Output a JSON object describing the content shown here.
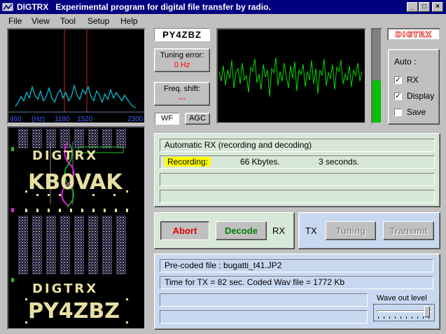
{
  "window": {
    "app_name": "DIGTRX",
    "subtitle": "Experimental program for digital file transfer by radio.",
    "controls": [
      "_",
      "□",
      "×"
    ]
  },
  "menu": [
    "File",
    "View",
    "Tool",
    "Setup",
    "Help"
  ],
  "spectrum": {
    "axis_labels": [
      "460",
      "(Hz)",
      "1180",
      "1520",
      "2300"
    ]
  },
  "waterfall": {
    "texts": [
      "DIGTRX",
      "KB0VAK",
      "DIGTRX",
      "PY4ZBZ"
    ]
  },
  "callsign": "PY4ZBZ",
  "tuning_error": {
    "label": "Tuning error:",
    "value": "0 Hz"
  },
  "freq_shift": {
    "label": "Freq. shift:",
    "value": "---"
  },
  "buttons": {
    "wf": "WF",
    "agc": "AGC"
  },
  "logo_text": "DIGTRX",
  "meter_level_percent": 45,
  "auto": {
    "title": "Auto :",
    "rx": {
      "label": "RX",
      "checked": true
    },
    "display": {
      "label": "Display",
      "checked": true
    },
    "save": {
      "label": "Save",
      "checked": false
    }
  },
  "status": {
    "line1": "Automatic RX (recording and decoding)",
    "recording_label": "Recording:",
    "kbytes": "66  Kbytes.",
    "seconds": "3  seconds."
  },
  "rx_controls": {
    "abort": "Abort",
    "decode": "Decode",
    "label": "RX"
  },
  "tx_controls": {
    "label": "TX",
    "tuning": "Tuning",
    "transmit": "Transmit"
  },
  "tx_info": {
    "precoded": "Pre-coded file : bugatti_t41.JP2",
    "time": "Time for TX = 82 sec.    Coded Wav file = 1772 Kb",
    "wave_out_label": "Wave out level"
  },
  "colors": {
    "title_bg": "#000080",
    "error_red": "#ff0000",
    "spectrum_trace": "#00c8d8",
    "scope_trace": "#00e000",
    "recording_highlight": "#ffff00",
    "abort_text": "#e00000",
    "decode_text": "#008000",
    "waterfall_text": "#e8e0a0"
  }
}
